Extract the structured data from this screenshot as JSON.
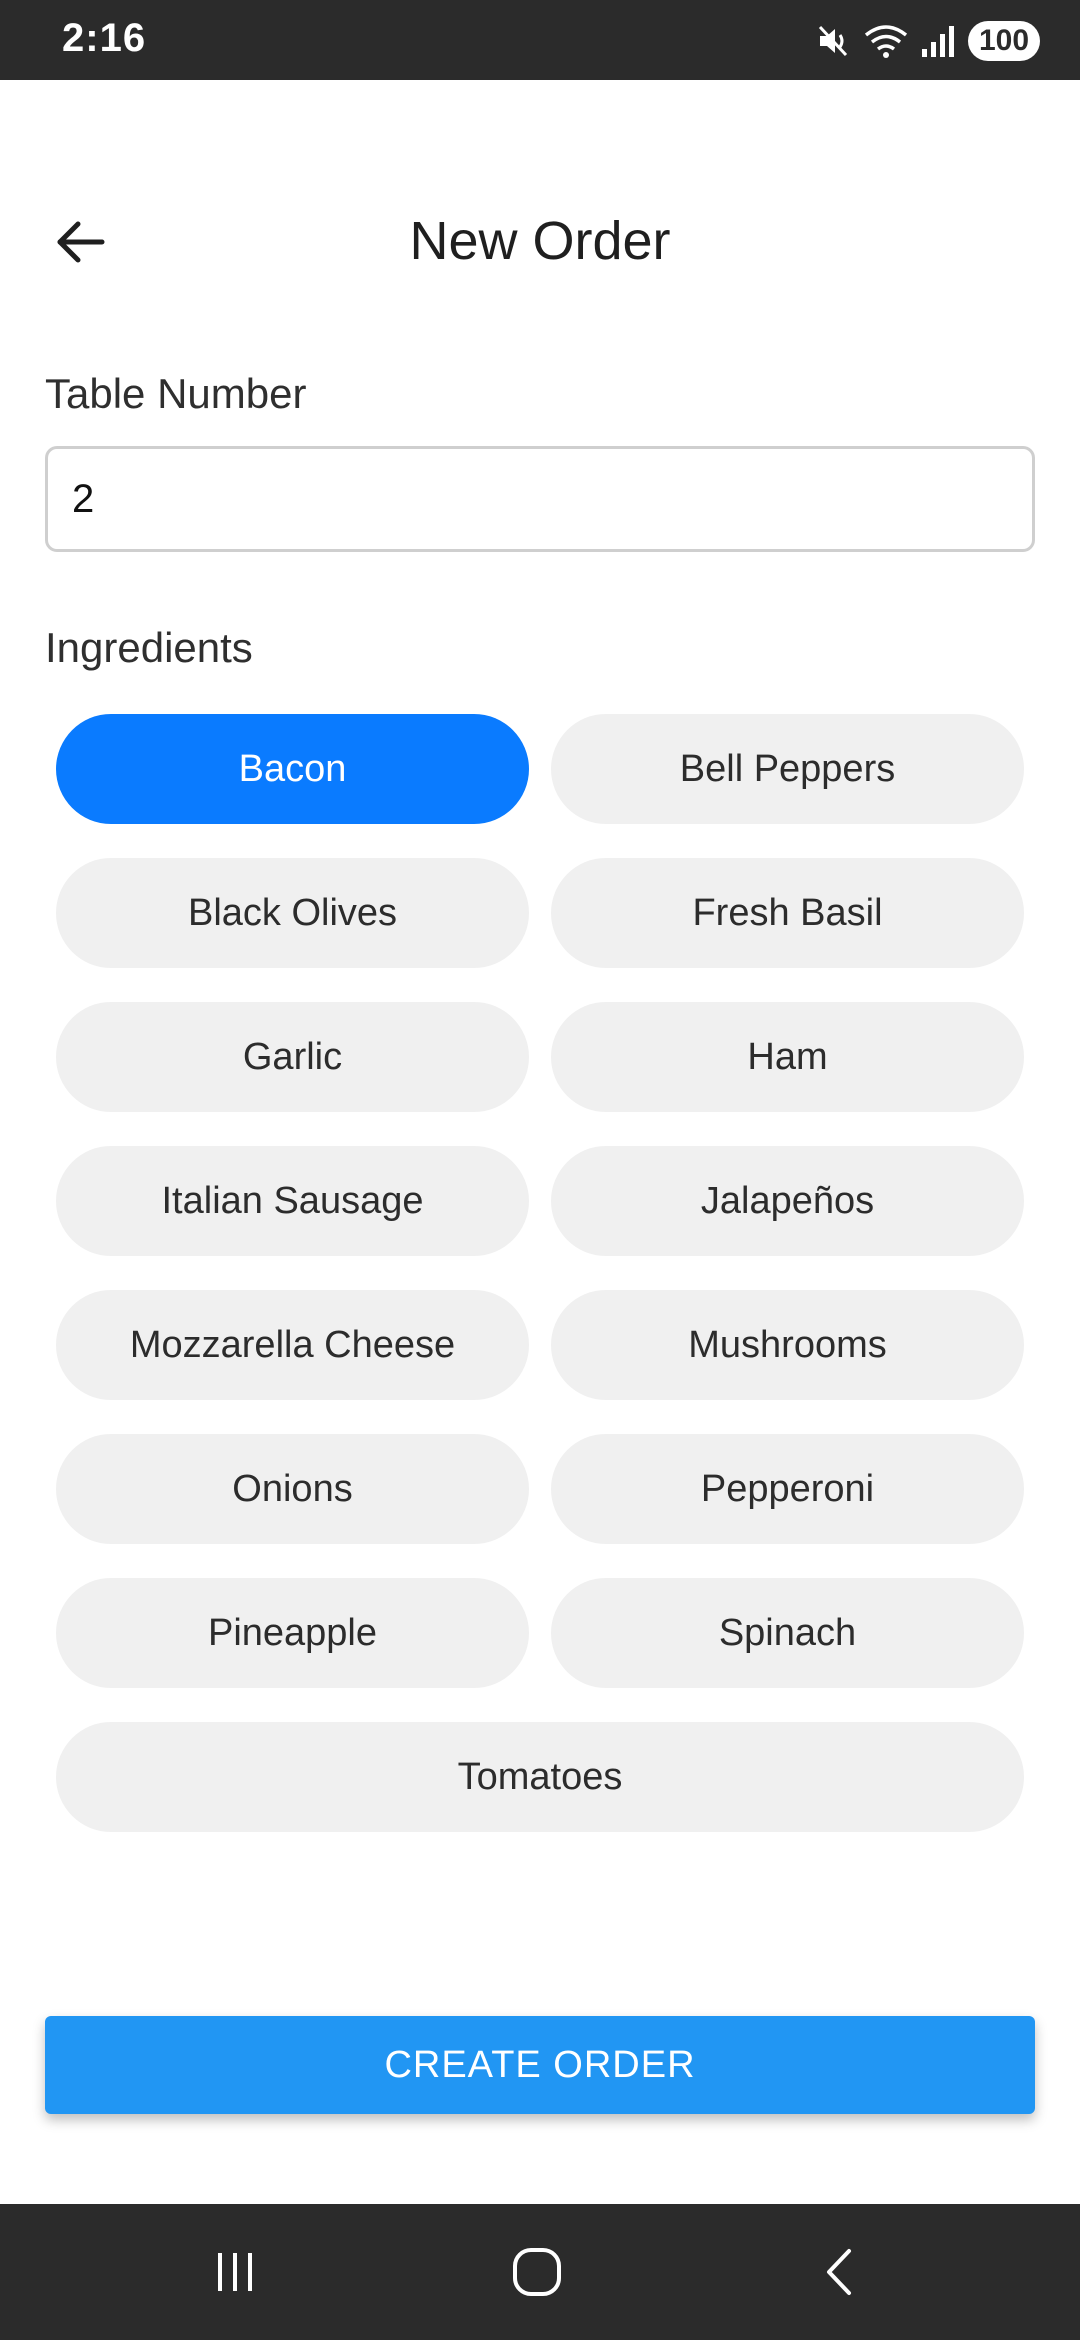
{
  "status_bar": {
    "time": "2:16",
    "battery": "100",
    "icons": [
      "mute-icon",
      "wifi-icon",
      "signal-icon",
      "battery-icon"
    ]
  },
  "header": {
    "title": "New Order",
    "back_icon": "arrow-left-icon"
  },
  "table_number": {
    "label": "Table Number",
    "value": "2",
    "placeholder": ""
  },
  "ingredients": {
    "label": "Ingredients",
    "items": [
      {
        "label": "Bacon",
        "selected": true
      },
      {
        "label": "Bell Peppers",
        "selected": false
      },
      {
        "label": "Black Olives",
        "selected": false
      },
      {
        "label": "Fresh Basil",
        "selected": false
      },
      {
        "label": "Garlic",
        "selected": false
      },
      {
        "label": "Ham",
        "selected": false
      },
      {
        "label": "Italian Sausage",
        "selected": false
      },
      {
        "label": "Jalapeños",
        "selected": false
      },
      {
        "label": "Mozzarella Cheese",
        "selected": false
      },
      {
        "label": "Mushrooms",
        "selected": false
      },
      {
        "label": "Onions",
        "selected": false
      },
      {
        "label": "Pepperoni",
        "selected": false
      },
      {
        "label": "Pineapple",
        "selected": false
      },
      {
        "label": "Spinach",
        "selected": false
      },
      {
        "label": "Tomatoes",
        "selected": false
      }
    ]
  },
  "actions": {
    "create_label": "CREATE ORDER"
  },
  "colors": {
    "accent": "#2196f3",
    "chip_selected": "#0a7bff",
    "chip_default": "#f0f0f0",
    "system_bars": "#2b2b2b"
  },
  "nav_bar": {
    "icons": [
      "recent-apps-icon",
      "home-icon",
      "back-icon"
    ]
  }
}
